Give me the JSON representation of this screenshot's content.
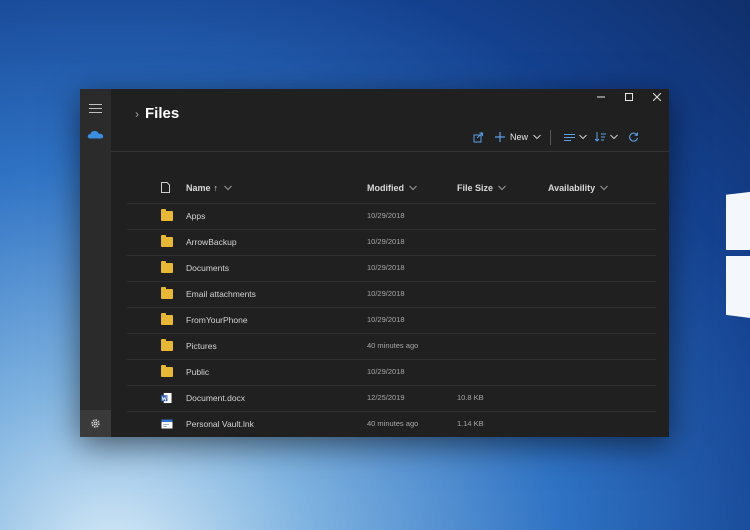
{
  "window": {
    "title": "Files",
    "controls": {
      "minimize": "—",
      "maximize": "☐",
      "close": "✕"
    }
  },
  "toolbar": {
    "new_label": "New"
  },
  "columns": {
    "name": "Name",
    "name_sort": "↑",
    "modified": "Modified",
    "size": "File Size",
    "availability": "Availability"
  },
  "files": [
    {
      "name": "Apps",
      "type": "folder",
      "modified": "10/29/2018",
      "size": ""
    },
    {
      "name": "ArrowBackup",
      "type": "folder",
      "modified": "10/29/2018",
      "size": ""
    },
    {
      "name": "Documents",
      "type": "folder",
      "modified": "10/29/2018",
      "size": ""
    },
    {
      "name": "Email attachments",
      "type": "folder",
      "modified": "10/29/2018",
      "size": ""
    },
    {
      "name": "FromYourPhone",
      "type": "folder",
      "modified": "10/29/2018",
      "size": ""
    },
    {
      "name": "Pictures",
      "type": "folder",
      "modified": "40 minutes ago",
      "size": ""
    },
    {
      "name": "Public",
      "type": "folder",
      "modified": "10/29/2018",
      "size": ""
    },
    {
      "name": "Document.docx",
      "type": "word-doc",
      "modified": "12/25/2019",
      "size": "10.8 KB"
    },
    {
      "name": "Personal Vault.lnk",
      "type": "link",
      "modified": "40 minutes ago",
      "size": "1.14 KB"
    }
  ],
  "icons": {
    "menu": "hamburger-icon",
    "cloud": "onedrive-cloud-icon",
    "settings": "gear-icon",
    "share": "share-icon",
    "new": "plus-icon",
    "view": "list-view-icon",
    "sort": "sort-icon",
    "refresh": "refresh-icon"
  },
  "colors": {
    "accent": "#3b8ee0",
    "folder": "#e8b735",
    "window_bg": "#202020"
  }
}
